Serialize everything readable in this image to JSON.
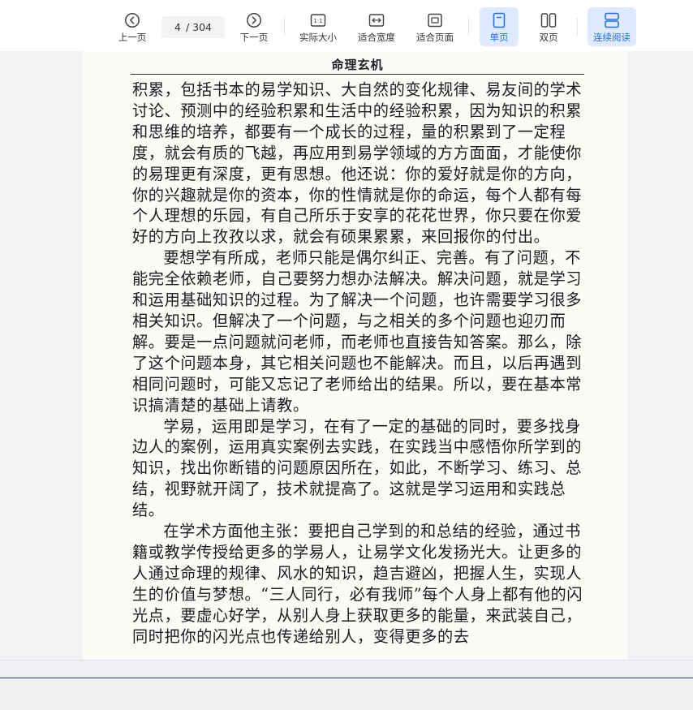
{
  "toolbar": {
    "prev_label": "上一页",
    "next_label": "下一页",
    "current_page": "4",
    "total_pages": "/ 304",
    "actual_size_label": "实际大小",
    "fit_width_label": "适合宽度",
    "fit_page_label": "适合页面",
    "single_page_label": "单页",
    "double_page_label": "双页",
    "continuous_label": "连续阅读",
    "actual_size_icon_text": "1:1",
    "accent_color": "#2a6ee8"
  },
  "document": {
    "running_head": "命理玄机",
    "paragraphs": [
      "积累，包括书本的易学知识、大自然的变化规律、易友间的学术讨论、预测中的经验积累和生活中的经验积累，因为知识的积累和思维的培养，都要有一个成长的过程，量的积累到了一定程度，就会有质的飞越，再应用到易学领域的方方面面，才能使你的易理更有深度，更有思想。他还说：你的爱好就是你的方向，你的兴趣就是你的资本，你的性情就是你的命运，每个人都有每个人理想的乐园，有自己所乐于安享的花花世界，你只要在你爱好的方向上孜孜以求，就会有硕果累累，来回报你的付出。",
      "要想学有所成，老师只能是偶尔纠正、完善。有了问题，不能完全依赖老师，自己要努力想办法解决。解决问题，就是学习和运用基础知识的过程。为了解决一个问题，也许需要学习很多相关知识。但解决了一个问题，与之相关的多个问题也迎刃而解。要是一点问题就问老师，而老师也直接告知答案。那么，除了这个问题本身，其它相关问题也不能解决。而且，以后再遇到相同问题时，可能又忘记了老师给出的结果。所以，要在基本常识搞清楚的基础上请教。",
      "学易，运用即是学习，在有了一定的基础的同时，要多找身边人的案例，运用真实案例去实践，在实践当中感悟你所学到的知识，找出你断错的问题原因所在，如此，不断学习、练习、总结，视野就开阔了，技术就提高了。这就是学习运用和实践总结。",
      "在学术方面他主张：要把自己学到的和总结的经验，通过书籍或教学传授给更多的学易人，让易学文化发扬光大。让更多的人通过命理的规律、风水的知识，趋吉避凶，把握人生，实现人生的价值与梦想。“三人同行，必有我师”每个人身上都有他的闪光点，要虚心好学，从别人身上获取更多的能量，来武装自己，同时把你的闪光点也传递给别人，变得更多的去"
    ]
  }
}
